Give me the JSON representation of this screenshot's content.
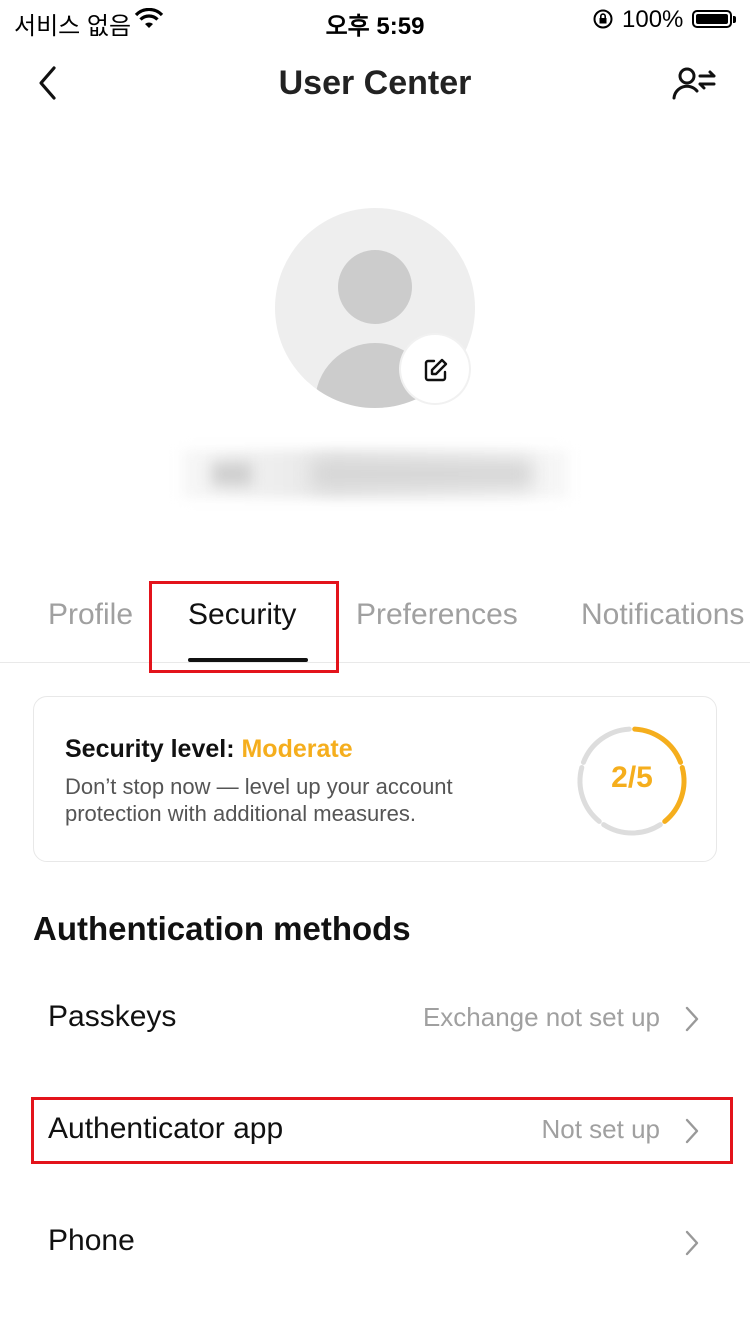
{
  "status_bar": {
    "carrier": "서비스 없음",
    "time": "오후 5:59",
    "battery": "100%"
  },
  "nav": {
    "title": "User Center"
  },
  "tabs": [
    {
      "label": "Profile"
    },
    {
      "label": "Security"
    },
    {
      "label": "Preferences"
    },
    {
      "label": "Notifications"
    }
  ],
  "security_card": {
    "level_label": "Security level:",
    "level_value": "Moderate",
    "description": "Don’t stop now — level up your account protection with additional measures.",
    "ratio": "2/5",
    "completed": 2,
    "total": 5
  },
  "section_title": "Authentication methods",
  "methods": [
    {
      "label": "Passkeys",
      "status": "Exchange not set up"
    },
    {
      "label": "Authenticator app",
      "status": "Not set up"
    },
    {
      "label": "Phone",
      "status": ""
    }
  ],
  "colors": {
    "accent": "#f5ae1d",
    "highlight": "#e3131b"
  }
}
